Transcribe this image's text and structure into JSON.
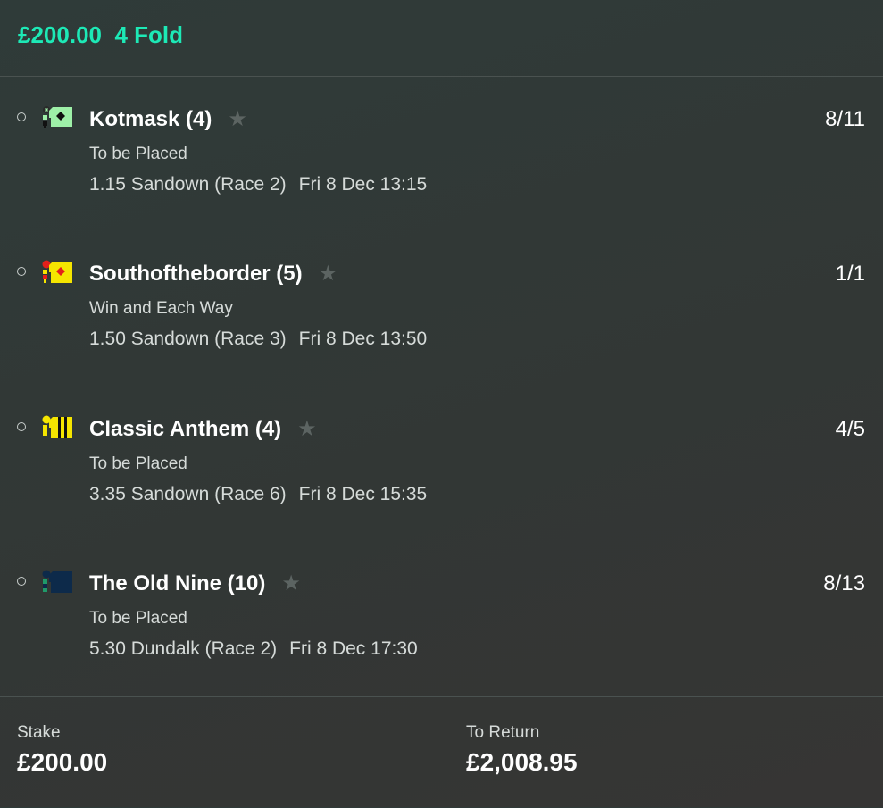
{
  "header": {
    "stake_amount": "£200.00",
    "bet_type": "4 Fold"
  },
  "selections": [
    {
      "runner": "Kotmask (4)",
      "odds": "8/11",
      "market": "To be Placed",
      "event": "1.15 Sandown (Race 2)",
      "time": "Fri 8 Dec 13:15",
      "silk": "silk-green-black-diamond-icon"
    },
    {
      "runner": "Southoftheborder (5)",
      "odds": "1/1",
      "market": "Win and Each Way",
      "event": "1.50 Sandown (Race 3)",
      "time": "Fri 8 Dec 13:50",
      "silk": "silk-yellow-red-diamond-icon"
    },
    {
      "runner": "Classic Anthem (4)",
      "odds": "4/5",
      "market": "To be Placed",
      "event": "3.35 Sandown (Race 6)",
      "time": "Fri 8 Dec 15:35",
      "silk": "silk-yellow-black-stripes-icon"
    },
    {
      "runner": "The Old Nine (10)",
      "odds": "8/13",
      "market": "To be Placed",
      "event": "5.30 Dundalk (Race 2)",
      "time": "Fri 8 Dec 17:30",
      "silk": "silk-navy-green-icon"
    }
  ],
  "footer": {
    "stake_label": "Stake",
    "stake_value": "£200.00",
    "return_label": "To Return",
    "return_value": "£2,008.95"
  },
  "colors": {
    "accent": "#1de9b6",
    "background": "#323735",
    "star": "#5c6462"
  }
}
